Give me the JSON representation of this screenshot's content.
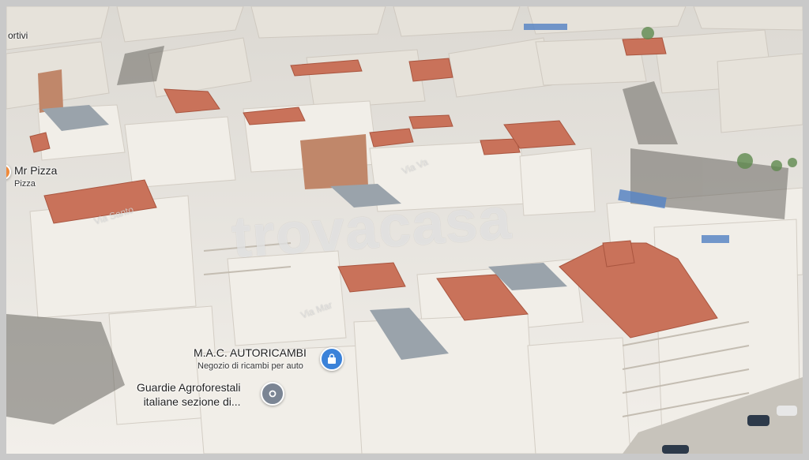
{
  "map": {
    "edge_label": "ortivi",
    "places": [
      {
        "name": "Mr Pizza",
        "category": "Pizza",
        "icon": "restaurant-pin-icon",
        "color": "#f08a3a"
      },
      {
        "name": "M.A.C. AUTORICAMBI",
        "category": "Negozio di ricambi per auto",
        "icon": "shopping-bag-pin-icon",
        "color": "#3b82d9"
      },
      {
        "name": "Guardie Agroforestali italiane sezione di...",
        "category": "",
        "icon": "place-pin-icon",
        "color": "#7b8594"
      }
    ],
    "streets": [
      "Via Santo",
      "Via Va",
      "Via Mar"
    ],
    "watermark": "trovacasa"
  }
}
